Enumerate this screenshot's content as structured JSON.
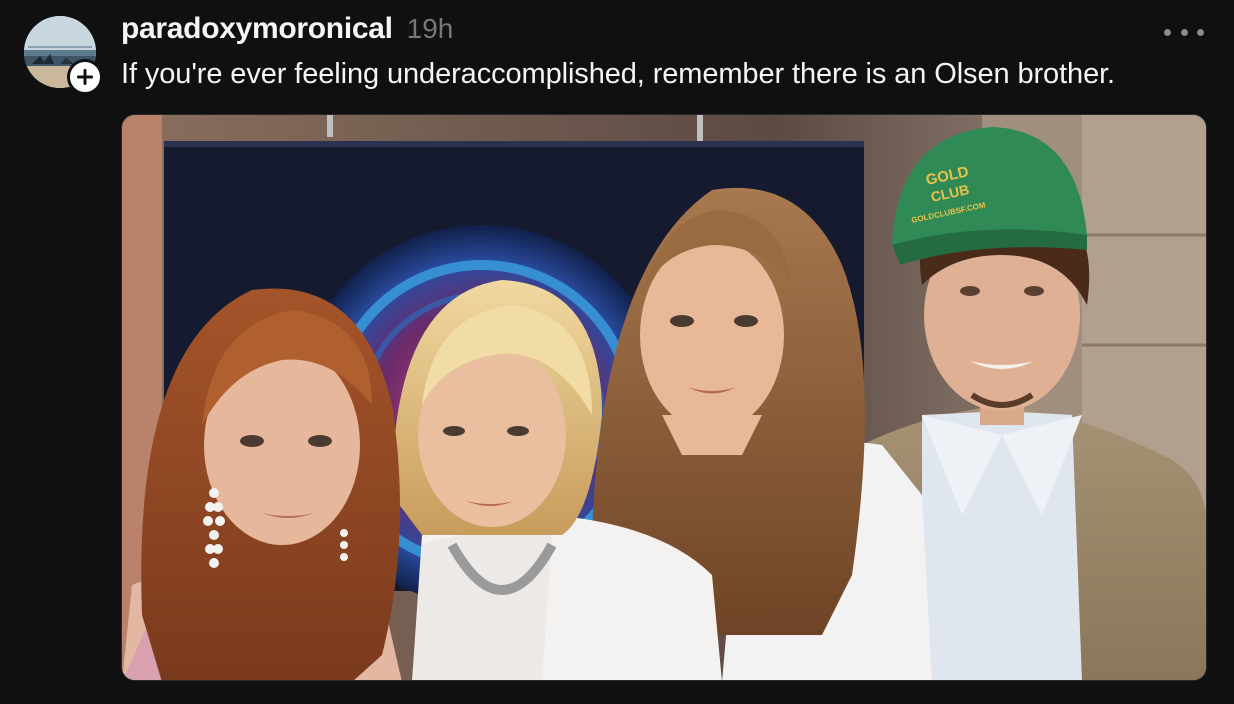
{
  "post": {
    "username": "paradoxymoronical",
    "timestamp": "19h",
    "text": "If you're ever feeling underaccomplished, remember there is an Olsen brother.",
    "photo": {
      "hat_text_line1": "GOLD",
      "hat_text_line2": "CLUB",
      "hat_text_line3": "GOLDCLUBSF.COM"
    }
  },
  "icons": {
    "follow": "plus-icon",
    "more": "more-horizontal-icon"
  },
  "colors": {
    "background": "#101010",
    "text_primary": "#f3f5f7",
    "text_secondary": "#777777"
  }
}
